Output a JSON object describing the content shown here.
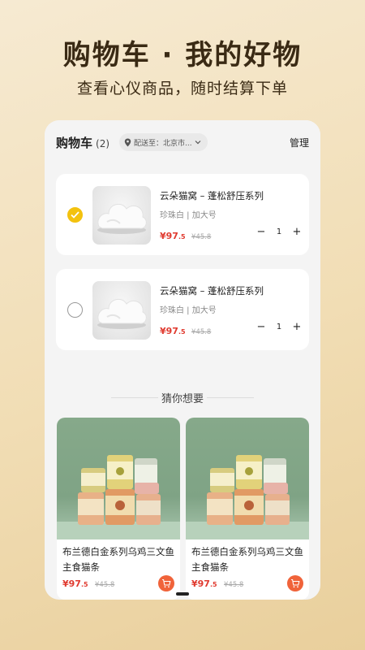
{
  "promo": {
    "title": "购物车 · 我的好物",
    "subtitle": "查看心仪商品，随时结算下单"
  },
  "header": {
    "title": "购物车",
    "count": "(2)",
    "address": "配送至：北京市...",
    "manage_label": "管理"
  },
  "cart_items": [
    {
      "name": "云朵猫窝 – 蓬松舒压系列",
      "spec": "珍珠白 | 加大号",
      "price": "¥97",
      "price_cents": ".5",
      "old_price": "¥45.8",
      "quantity": "1",
      "checked": true
    },
    {
      "name": "云朵猫窝 – 蓬松舒压系列",
      "spec": "珍珠白 | 加大号",
      "price": "¥97",
      "price_cents": ".5",
      "old_price": "¥45.8",
      "quantity": "1",
      "checked": false
    }
  ],
  "recommend": {
    "heading": "猜你想要",
    "products": [
      {
        "title": "布兰德白金系列乌鸡三文鱼主食猫条",
        "price": "¥97",
        "price_cents": ".5",
        "old_price": "¥45.8"
      },
      {
        "title": "布兰德白金系列乌鸡三文鱼主食猫条",
        "price": "¥97",
        "price_cents": ".5",
        "old_price": "¥45.8"
      }
    ]
  },
  "icons": {
    "location": "location-pin-icon",
    "dropdown": "chevron-down-icon",
    "check": "check-icon",
    "cart": "cart-icon"
  },
  "colors": {
    "accent_yellow": "#f3c20f",
    "price_red": "#e03a2f",
    "cart_orange": "#f0633a"
  }
}
